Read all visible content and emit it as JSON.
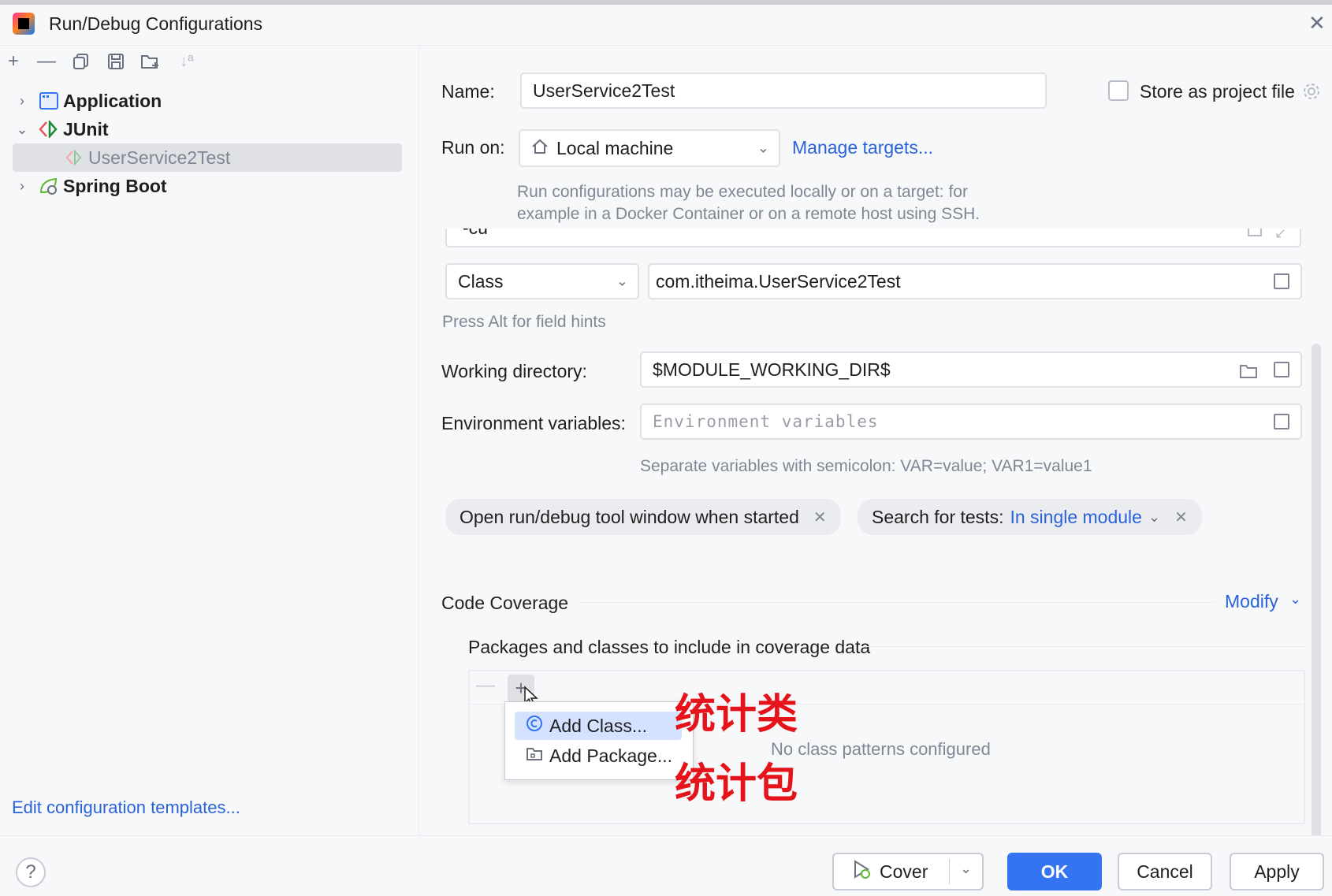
{
  "window": {
    "title": "Run/Debug Configurations"
  },
  "toolbar": {
    "add_icon": "plus-icon",
    "remove_icon": "minus-icon",
    "copy_icon": "copy-icon",
    "save_icon": "save-icon",
    "folder_icon": "new-folder-icon",
    "sort_icon": "sort-alpha-icon"
  },
  "tree": {
    "items": [
      {
        "label": "Application",
        "expanded": false
      },
      {
        "label": "JUnit",
        "expanded": true
      },
      {
        "label": "UserService2Test",
        "selected": true
      },
      {
        "label": "Spring Boot",
        "expanded": false
      }
    ]
  },
  "left_footer": {
    "edit_templates": "Edit configuration templates..."
  },
  "form": {
    "name_label": "Name:",
    "name_value": "UserService2Test",
    "store_label": "Store as project file",
    "run_on_label": "Run on:",
    "run_on_value": "Local machine",
    "manage_targets": "Manage targets...",
    "run_on_hint_line1": "Run configurations may be executed locally or on a target: for",
    "run_on_hint_line2": "example in a Docker Container or on a remote host using SSH.",
    "partial_field_text": "-cu",
    "class_select": "Class",
    "class_value": "com.itheima.UserService2Test",
    "field_hints": "Press Alt for field hints",
    "working_dir_label": "Working directory:",
    "working_dir_value": "$MODULE_WORKING_DIR$",
    "env_label": "Environment variables:",
    "env_placeholder": "Environment variables",
    "env_hint": "Separate variables with semicolon: VAR=value; VAR1=value1",
    "chip_open_tool_window": "Open run/debug tool window when started",
    "chip_search_label": "Search for tests:",
    "chip_search_value": "In single module"
  },
  "coverage": {
    "section_title": "Code Coverage",
    "modify_label": "Modify",
    "packages_title": "Packages and classes to include in coverage data",
    "empty_text": "No class patterns configured",
    "popup": {
      "add_class": "Add Class...",
      "add_package": "Add Package..."
    }
  },
  "annotations": {
    "class_note": "统计类",
    "package_note": "统计包"
  },
  "buttons": {
    "cover": "Cover",
    "ok": "OK",
    "cancel": "Cancel",
    "apply": "Apply"
  },
  "colors": {
    "accent": "#3574f0",
    "link": "#2a63d9",
    "annotation": "#e5141b",
    "selection": "#dfe1e5"
  }
}
